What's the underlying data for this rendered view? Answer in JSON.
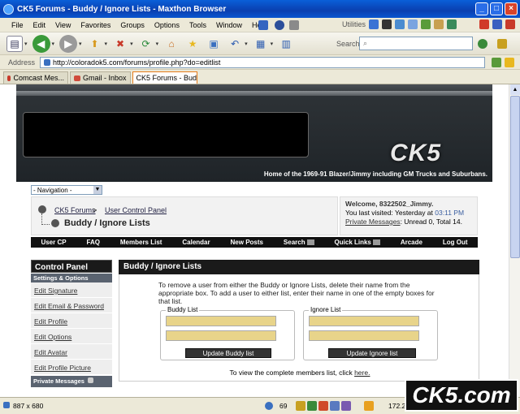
{
  "window": {
    "title": "CK5 Forums - Buddy / Ignore Lists - Maxthon Browser"
  },
  "menu": [
    "File",
    "Edit",
    "View",
    "Favorites",
    "Groups",
    "Options",
    "Tools",
    "Window",
    "Help"
  ],
  "menu_right": {
    "utilities": "Utilities"
  },
  "toolbar": {
    "search_label": "Search"
  },
  "address": {
    "label": "Address",
    "url": "http://coloradok5.com/forums/profile.php?do=editlist"
  },
  "tabs": [
    {
      "label": "Comcast Mes..."
    },
    {
      "label": "Gmail - Inbox"
    },
    {
      "label": "CK5 Forums - Bud..."
    }
  ],
  "forum": {
    "logo": "CK5",
    "tagline": "Home of the 1969-91 Blazer/Jimmy including GM Trucks and Suburbans.",
    "nav_dropdown": "- Navigation -",
    "breadcrumb": {
      "root": "CK5 Forums",
      "sep": ">",
      "section": "User Control Panel",
      "title": "Buddy / Ignore Lists"
    },
    "welcome": {
      "greeting": "Welcome, 8322502_Jimmy.",
      "visited_prefix": "You last visited: Yesterday at",
      "visited_time": "03:11 PM",
      "pm_link": "Private Messages",
      "pm_text": ": Unread 0, Total 14."
    },
    "navbar": [
      "User CP",
      "FAQ",
      "Members List",
      "Calendar",
      "New Posts",
      "Search",
      "Quick Links",
      "Arcade",
      "Log Out"
    ],
    "sidebar": {
      "title": "Control Panel",
      "section1": "Settings & Options",
      "items": [
        "Edit Signature",
        "Edit Email & Password",
        "Edit Profile",
        "Edit Options",
        "Edit Avatar",
        "Edit Profile Picture"
      ],
      "section2": "Private Messages"
    },
    "main": {
      "title": "Buddy / Ignore Lists",
      "instructions": "To remove a user from either the Buddy or Ignore Lists, delete their name from the appropriate box. To add a user to either list, enter their name in one of the empty boxes for that list.",
      "buddy_legend": "Buddy List",
      "ignore_legend": "Ignore List",
      "buddy_button": "Update Buddy list",
      "ignore_button": "Update Ignore list",
      "members_text": "To view the complete members list, click",
      "members_link": "here."
    }
  },
  "status": {
    "size": "887 x 680",
    "count": "69",
    "num": "172.2"
  },
  "watermark": "CK5.com"
}
